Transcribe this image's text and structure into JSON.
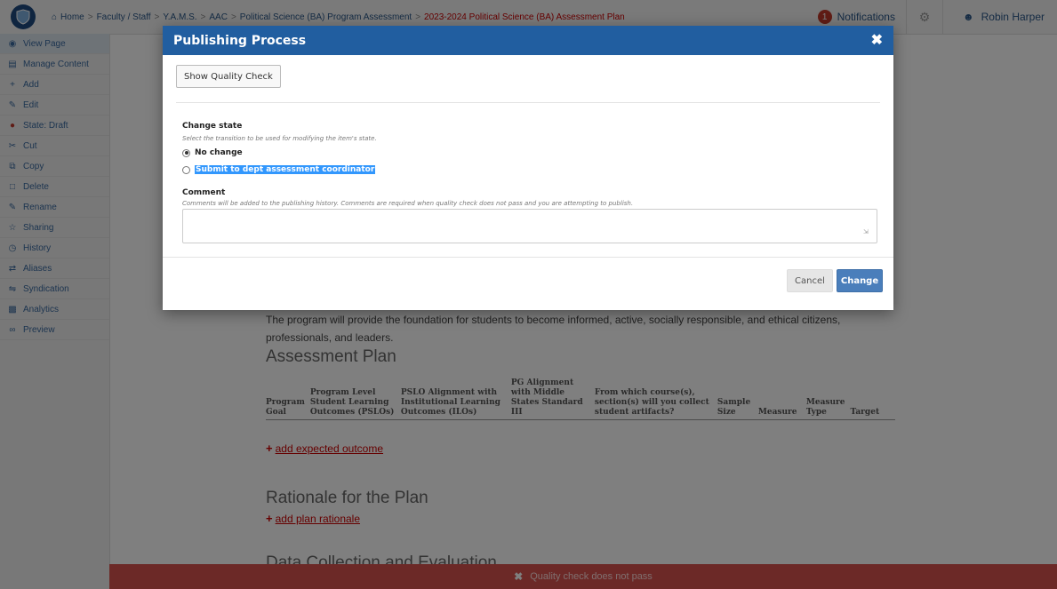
{
  "topbar": {
    "breadcrumbs": [
      {
        "label": "Home"
      },
      {
        "label": "Faculty / Staff"
      },
      {
        "label": "Y.A.M.S."
      },
      {
        "label": "AAC"
      },
      {
        "label": "Political Science (BA) Program Assessment"
      },
      {
        "label": "2023-2024 Political Science (BA) Assessment Plan"
      }
    ],
    "notifications_label": "Notifications",
    "notifications_count": "1",
    "user_name": "Robin Harper"
  },
  "sidebar": {
    "items": [
      {
        "label": "View Page",
        "icon": "eye-icon"
      },
      {
        "label": "Manage Content",
        "icon": "folder-icon"
      },
      {
        "label": "Add",
        "icon": "plus-icon"
      },
      {
        "label": "Edit",
        "icon": "pencil-icon"
      },
      {
        "label": "State: Draft",
        "icon": "state-icon"
      },
      {
        "label": "Cut",
        "icon": "scissors-icon"
      },
      {
        "label": "Copy",
        "icon": "copy-icon"
      },
      {
        "label": "Delete",
        "icon": "trash-icon"
      },
      {
        "label": "Rename",
        "icon": "rename-icon"
      },
      {
        "label": "Sharing",
        "icon": "share-icon"
      },
      {
        "label": "History",
        "icon": "history-icon"
      },
      {
        "label": "Aliases",
        "icon": "alias-icon"
      },
      {
        "label": "Syndication",
        "icon": "syndication-icon"
      },
      {
        "label": "Analytics",
        "icon": "analytics-icon"
      },
      {
        "label": "Preview",
        "icon": "preview-icon"
      }
    ]
  },
  "page": {
    "mission_text": "The program will provide the foundation for students to become informed, active, socially responsible, and ethical citizens, professionals, and leaders.",
    "assessment_heading": "Assessment Plan",
    "table_headers": [
      "Program Goal",
      "Program Level Student Learning Outcomes (PSLOs)",
      "PSLO Alignment with Institutional Learning Outcomes (ILOs)",
      "PG Alignment with Middle States Standard III",
      "From which course(s), section(s) will you collect student artifacts?",
      "Sample Size",
      "Measure",
      "Measure Type",
      "Target"
    ],
    "add_outcome_label": "add expected outcome",
    "rationale_heading": "Rationale for the Plan",
    "add_rationale_label": "add plan rationale",
    "data_heading": "Data Collection and Evaluation"
  },
  "footer": {
    "message": "Quality check does not pass"
  },
  "modal": {
    "title": "Publishing Process",
    "quality_check_label": "Show Quality Check",
    "change_state_label": "Change state",
    "change_state_help": "Select the transition to be used for modifying the item's state.",
    "options": [
      {
        "label": "No change",
        "checked": true
      },
      {
        "label": "Submit to dept assessment coordinator",
        "checked": false
      }
    ],
    "comment_label": "Comment",
    "comment_help": "Comments will be added to the publishing history. Comments are required when quality check does not pass and you are attempting to publish.",
    "comment_value": "",
    "cancel_label": "Cancel",
    "change_label": "Change"
  },
  "colors": {
    "modal_header": "#215ea0",
    "change_button": "#4a7ebb",
    "footer_bar": "#d9534f",
    "link_red": "#cc0000"
  }
}
